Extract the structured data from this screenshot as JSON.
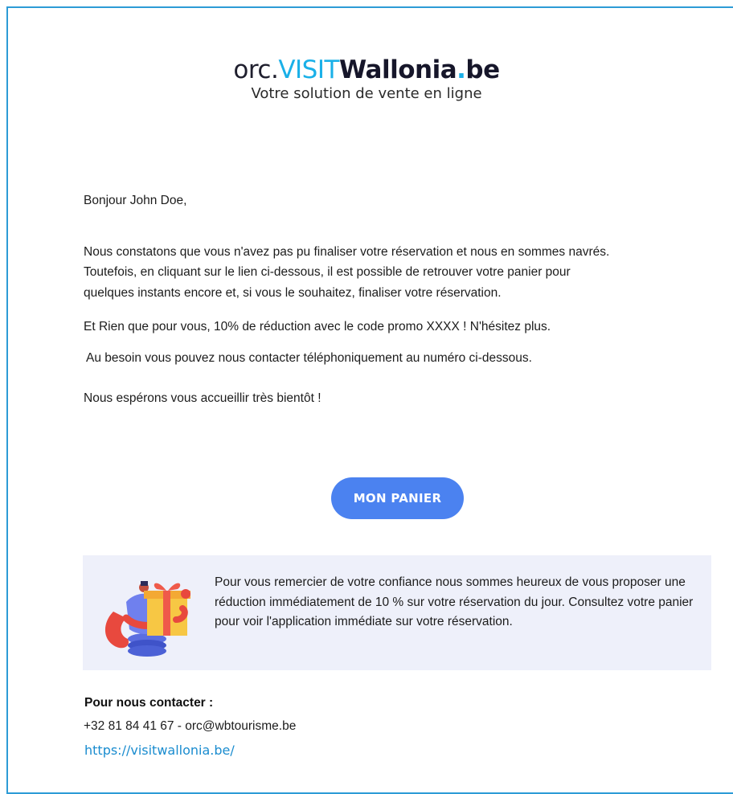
{
  "logo": {
    "orc": "orc.",
    "visit": "VISIT",
    "wallonia": "Wallonia",
    "dot": ".",
    "be": "be",
    "tagline": "Votre solution de vente en ligne"
  },
  "email": {
    "greeting": "Bonjour John Doe,",
    "paragraph1_line1": "Nous constatons que vous n'avez pas pu finaliser votre réservation et nous en sommes navrés.",
    "paragraph1_line2": "Toutefois, en cliquant sur le lien ci-dessous, il est possible de retrouver votre panier pour",
    "paragraph1_line3": "quelques instants encore et, si vous le souhaitez, finaliser votre réservation.",
    "paragraph2": "Et Rien que pour vous, 10% de réduction avec le code promo XXXX ! N'hésitez plus.",
    "paragraph3": "Au besoin vous pouvez nous contacter téléphoniquement au numéro ci-dessous.",
    "paragraph4": "Nous espérons vous accueillir très bientôt !",
    "button_label": "MON PANIER"
  },
  "promo": {
    "illustration_icon": "gift-person-icon",
    "text": "Pour vous remercier de votre confiance nous sommes heureux de vous proposer une réduction immédiatement de 10 % sur votre réservation du jour. Consultez votre panier pour voir l'application immédiate sur votre réservation."
  },
  "contact": {
    "heading": "Pour nous contacter :",
    "phone_email": "+32 81 84 41 67 - orc@wbtourisme.be",
    "website": "https://visitwallonia.be/"
  },
  "colors": {
    "frame_border": "#2d9bd6",
    "brand_blue": "#1ab0e8",
    "button": "#4b82f0",
    "promo_background": "#eef0fa",
    "link": "#1a8ccf"
  }
}
